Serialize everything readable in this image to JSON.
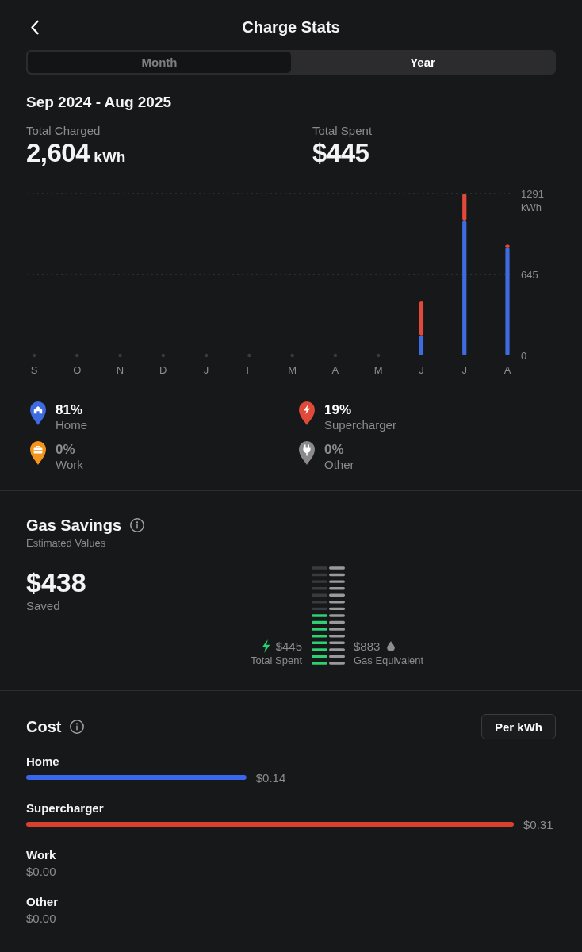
{
  "header": {
    "title": "Charge Stats"
  },
  "tabs": [
    {
      "label": "Month",
      "selected": false
    },
    {
      "label": "Year",
      "selected": true
    }
  ],
  "summary": {
    "period": "Sep 2024 - Aug 2025",
    "totals": [
      {
        "label": "Total Charged",
        "value": "2,604",
        "unit": "kWh"
      },
      {
        "label": "Total Spent",
        "value": "$445"
      }
    ]
  },
  "energy_chart": {
    "chart_data": {
      "type": "bar",
      "stacked": true,
      "categories": [
        "S",
        "O",
        "N",
        "D",
        "J",
        "F",
        "M",
        "A",
        "M",
        "J",
        "J",
        "A"
      ],
      "ylabel": "kWh",
      "ylim": [
        0,
        1291
      ],
      "yticks": [
        0,
        645,
        1291
      ],
      "series": [
        {
          "name": "Home",
          "color": "#3e6be0",
          "values": [
            0,
            0,
            0,
            0,
            0,
            0,
            0,
            0,
            0,
            160,
            1076,
            862
          ]
        },
        {
          "name": "Supercharger",
          "color": "#e04a38",
          "values": [
            0,
            0,
            0,
            0,
            0,
            0,
            0,
            0,
            0,
            270,
            215,
            21
          ]
        },
        {
          "name": "Work",
          "color": "#f5941c",
          "values": [
            0,
            0,
            0,
            0,
            0,
            0,
            0,
            0,
            0,
            0,
            0,
            0
          ]
        },
        {
          "name": "Other",
          "color": "#8a8a8e",
          "values": [
            0,
            0,
            0,
            0,
            0,
            0,
            0,
            0,
            0,
            0,
            0,
            0
          ]
        }
      ]
    },
    "legend": [
      {
        "kind": "home",
        "percent": "81%",
        "dimmed": false
      },
      {
        "kind": "supercharger",
        "percent": "19%",
        "dimmed": false
      },
      {
        "kind": "work",
        "percent": "0%",
        "dimmed": true
      },
      {
        "kind": "other",
        "percent": "0%",
        "dimmed": true
      }
    ]
  },
  "gas_savings": {
    "title": "Gas Savings",
    "subtitle": "Estimated Values",
    "saved": {
      "value": "$438",
      "label": "Saved"
    },
    "spent": {
      "value": "$445",
      "label": "Total Spent"
    },
    "gas_equivalent": {
      "value": "$883",
      "label": "Gas Equivalent"
    },
    "meter": {
      "level": 0.5
    }
  },
  "cost": {
    "title": "Cost",
    "unit_button": "Per kWh",
    "chart_data": {
      "type": "bar",
      "orientation": "horizontal",
      "categories": [
        "Home",
        "Supercharger",
        "Work",
        "Other"
      ],
      "values": [
        0.14,
        0.31,
        0,
        0
      ],
      "colors": [
        "#3a66ee",
        "#d9412f",
        null,
        null
      ],
      "xlim": [
        0,
        0.31
      ],
      "value_labels": [
        "$0.14",
        "$0.31",
        "$0.00",
        "$0.00"
      ]
    }
  }
}
